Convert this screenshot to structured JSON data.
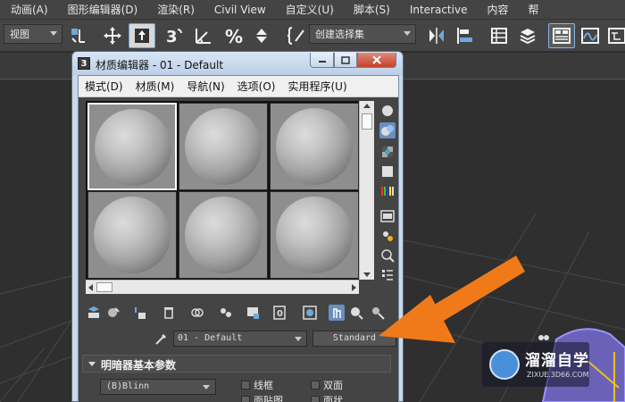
{
  "menubar": {
    "items": [
      "动画(A)",
      "图形编辑器(D)",
      "渲染(R)",
      "Civil View",
      "自定义(U)",
      "脚本(S)",
      "Interactive",
      "内容",
      "帮"
    ]
  },
  "toolbar": {
    "view_dropdown": "视图",
    "selection_set_dropdown": "创建选择集"
  },
  "material_editor": {
    "title": "材质编辑器 - 01 - Default",
    "app_icon_label": "3",
    "menu": [
      "模式(D)",
      "材质(M)",
      "导航(N)",
      "选项(O)",
      "实用程序(U)"
    ],
    "material_name": "01 - Default",
    "material_type": "Standard",
    "rollout_title": "明暗器基本参数",
    "shader": "(B)Blinn",
    "options": {
      "wire": "线框",
      "two_sided": "双面",
      "face_map": "面贴图",
      "faceted": "面状"
    },
    "selected_slot": 1
  },
  "watermark": {
    "title": "溜溜自学",
    "url": "ZIXUE.3D66.COM"
  },
  "colors": {
    "ui_dark": "#444444",
    "window_frame": "#c9d9ec",
    "accent_arrow": "#f07a1a",
    "close_button": "#c4412c",
    "watermark_circle": "#4a90d9"
  }
}
